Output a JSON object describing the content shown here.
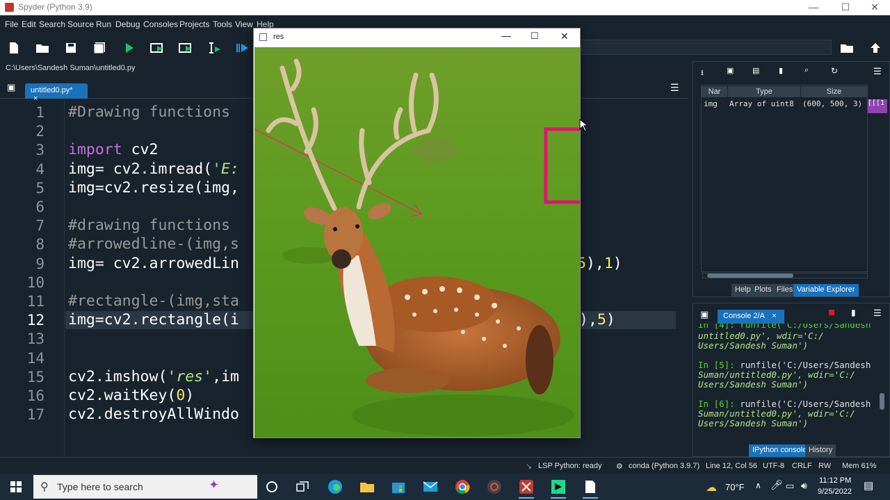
{
  "app": {
    "title": "Spyder (Python 3.9)"
  },
  "menu": [
    "File",
    "Edit",
    "Search",
    "Source",
    "Run",
    "Debug",
    "Consoles",
    "Projects",
    "Tools",
    "View",
    "Help"
  ],
  "file_path": "C:\\Users\\Sandesh Suman\\untitled0.py",
  "editor": {
    "tab_label": "untitled0.py*",
    "tab_close": "×",
    "current_line": 12,
    "lines": [
      {
        "n": "1",
        "text": "#Drawing functions"
      },
      {
        "n": "2",
        "text": ""
      },
      {
        "n": "3",
        "kw": "import",
        "rest": " cv2"
      },
      {
        "n": "4",
        "pre": "img= cv2.imread(",
        "str": "'E:"
      },
      {
        "n": "5",
        "text": "img=cv2.resize(img,"
      },
      {
        "n": "6",
        "text": ""
      },
      {
        "n": "7",
        "text": "#drawing functions"
      },
      {
        "n": "8",
        "text": "#arrowedline-(img,s"
      },
      {
        "n": "9",
        "pre": "img= cv2.arrowedLin",
        "tail_num": "5",
        "tail": "),",
        "tail_num2": "1",
        "tail_end": ")"
      },
      {
        "n": "10",
        "text": ""
      },
      {
        "n": "11",
        "text": "#rectangle-(img,sta"
      },
      {
        "n": "12",
        "pre": "img=cv2.rectangle(i",
        "tail": "),",
        "tail_num": "5",
        "tail_end": ")"
      },
      {
        "n": "13",
        "text": ""
      },
      {
        "n": "14",
        "text": ""
      },
      {
        "n": "15",
        "pre": "cv2.imshow(",
        "str": "'res'",
        "rest": ",im"
      },
      {
        "n": "16",
        "pre": "cv2.waitKey(",
        "num": "0",
        "rest": ")"
      },
      {
        "n": "17",
        "text": "cv2.destroyAllWindo"
      }
    ]
  },
  "variable_explorer": {
    "columns": [
      "Nar",
      "Type",
      "Size"
    ],
    "rows": [
      {
        "name": "img",
        "type": "Array of uint8",
        "size": "(600, 500, 3)",
        "value": "[[[1"
      }
    ],
    "tabs": [
      "Help",
      "Plots",
      "Files",
      "Variable Explorer"
    ],
    "active_tab": "Variable Explorer"
  },
  "console": {
    "tab_label": "Console 2/A",
    "lines": [
      {
        "prompt": "",
        "code": "Users/Sandesh Suman')",
        "pre": "untitled0.py', wdir='C:/"
      },
      {
        "prompt": "In [5]:",
        "code": " runfile('C:/Users/Sandesh",
        "l2": "Suman/untitled0.py', wdir='C:/",
        "l3": "Users/Sandesh Suman')"
      },
      {
        "prompt": "In [6]:",
        "code": " runfile('C:/Users/Sandesh",
        "l2": "Suman/untitled0.py', wdir='C:/",
        "l3": "Users/Sandesh Suman')"
      }
    ],
    "partial_top": "In [4]: runfile('C:/Users/Sandesh",
    "tabs": [
      "IPython console",
      "History"
    ],
    "active_tab": "IPython console"
  },
  "status": {
    "lsp": "LSP Python: ready",
    "env": "conda (Python 3.9.7)",
    "position": "Line 12, Col 56",
    "encoding": "UTF-8",
    "eol": "CRLF",
    "perm": "RW",
    "mem": "Mem 61%"
  },
  "image_window": {
    "title": "res"
  },
  "taskbar": {
    "search_placeholder": "Type here to search",
    "weather": "70°F",
    "time": "11:12 PM",
    "date": "9/25/2022"
  },
  "colors": {
    "background": "#19232d",
    "accent": "#1a72bb",
    "rectangle": "#e0156f",
    "arrow": "#e0305a"
  }
}
